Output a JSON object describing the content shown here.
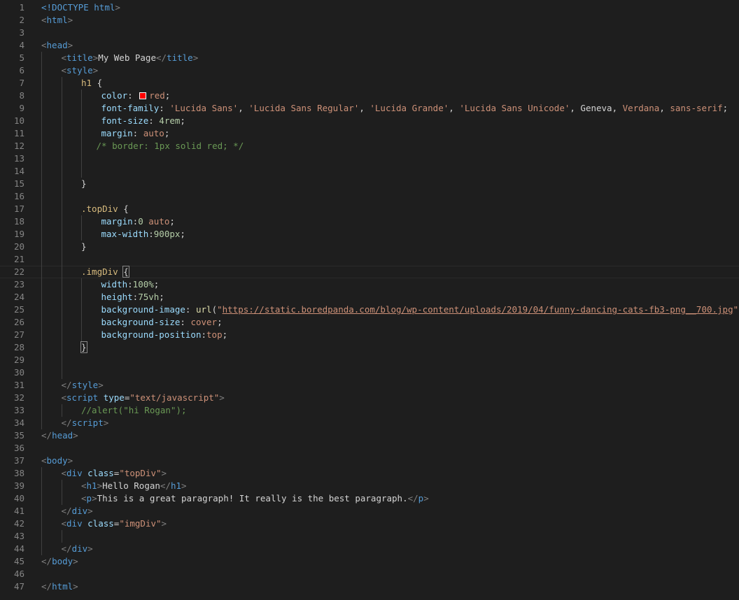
{
  "editor": {
    "lines": [
      {
        "n": "1",
        "indent": 0,
        "t": [
          [
            "doc",
            "<!DOCTYPE "
          ],
          [
            "tag",
            "html"
          ],
          [
            "punct",
            ">"
          ]
        ]
      },
      {
        "n": "2",
        "indent": 0,
        "t": [
          [
            "punct",
            "<"
          ],
          [
            "tag",
            "html"
          ],
          [
            "punct",
            ">"
          ]
        ]
      },
      {
        "n": "3",
        "indent": 0,
        "t": []
      },
      {
        "n": "4",
        "indent": 0,
        "t": [
          [
            "punct",
            "<"
          ],
          [
            "tag",
            "head"
          ],
          [
            "punct",
            ">"
          ]
        ]
      },
      {
        "n": "5",
        "indent": 1,
        "t": [
          [
            "punct",
            "<"
          ],
          [
            "tag",
            "title"
          ],
          [
            "punct",
            ">"
          ],
          [
            "txt",
            "My Web Page"
          ],
          [
            "punct",
            "</"
          ],
          [
            "tag",
            "title"
          ],
          [
            "punct",
            ">"
          ]
        ]
      },
      {
        "n": "6",
        "indent": 1,
        "t": [
          [
            "punct",
            "<"
          ],
          [
            "tag",
            "style"
          ],
          [
            "punct",
            ">"
          ]
        ]
      },
      {
        "n": "7",
        "indent": 2,
        "t": [
          [
            "sel",
            "h1"
          ],
          [
            "txt",
            " {"
          ]
        ]
      },
      {
        "n": "8",
        "indent": 3,
        "t": [
          [
            "prop",
            "color"
          ],
          [
            "txt",
            ": "
          ],
          [
            "swatch",
            ""
          ],
          [
            "val",
            "red"
          ],
          [
            "txt",
            ";"
          ]
        ]
      },
      {
        "n": "9",
        "indent": 3,
        "t": [
          [
            "prop",
            "font-family"
          ],
          [
            "txt",
            ": "
          ],
          [
            "val",
            "'Lucida Sans'"
          ],
          [
            "txt",
            ", "
          ],
          [
            "val",
            "'Lucida Sans Regular'"
          ],
          [
            "txt",
            ", "
          ],
          [
            "val",
            "'Lucida Grande'"
          ],
          [
            "txt",
            ", "
          ],
          [
            "val",
            "'Lucida Sans Unicode'"
          ],
          [
            "txt",
            ", Geneva, "
          ],
          [
            "val",
            "Verdana"
          ],
          [
            "txt",
            ", "
          ],
          [
            "val",
            "sans-serif"
          ],
          [
            "txt",
            ";"
          ]
        ]
      },
      {
        "n": "10",
        "indent": 3,
        "t": [
          [
            "prop",
            "font-size"
          ],
          [
            "txt",
            ": "
          ],
          [
            "num",
            "4rem"
          ],
          [
            "txt",
            ";"
          ]
        ]
      },
      {
        "n": "11",
        "indent": 3,
        "t": [
          [
            "prop",
            "margin"
          ],
          [
            "txt",
            ": "
          ],
          [
            "val",
            "auto"
          ],
          [
            "txt",
            ";"
          ]
        ]
      },
      {
        "n": "12",
        "indent": 3,
        "t": [
          [
            "cmt",
            "/* border: 1px solid red; */"
          ]
        ],
        "shift": -7
      },
      {
        "n": "13",
        "indent": 0,
        "t": []
      },
      {
        "n": "14",
        "indent": 0,
        "t": []
      },
      {
        "n": "15",
        "indent": 2,
        "t": [
          [
            "txt",
            "}"
          ]
        ]
      },
      {
        "n": "16",
        "indent": 0,
        "t": []
      },
      {
        "n": "17",
        "indent": 2,
        "t": [
          [
            "sel",
            ".topDiv"
          ],
          [
            "txt",
            " {"
          ]
        ]
      },
      {
        "n": "18",
        "indent": 3,
        "t": [
          [
            "prop",
            "margin"
          ],
          [
            "txt",
            ":"
          ],
          [
            "num",
            "0"
          ],
          [
            "txt",
            " "
          ],
          [
            "val",
            "auto"
          ],
          [
            "txt",
            ";"
          ]
        ]
      },
      {
        "n": "19",
        "indent": 3,
        "t": [
          [
            "prop",
            "max-width"
          ],
          [
            "txt",
            ":"
          ],
          [
            "num",
            "900px"
          ],
          [
            "txt",
            ";"
          ]
        ]
      },
      {
        "n": "20",
        "indent": 2,
        "t": [
          [
            "txt",
            "}"
          ]
        ]
      },
      {
        "n": "21",
        "indent": 0,
        "t": []
      },
      {
        "n": "22",
        "indent": 2,
        "t": [
          [
            "sel",
            ".imgDiv"
          ],
          [
            "txt",
            " "
          ],
          [
            "box",
            "{"
          ]
        ],
        "current": true
      },
      {
        "n": "23",
        "indent": 3,
        "t": [
          [
            "prop",
            "width"
          ],
          [
            "txt",
            ":"
          ],
          [
            "num",
            "100%"
          ],
          [
            "txt",
            ";"
          ]
        ]
      },
      {
        "n": "24",
        "indent": 3,
        "t": [
          [
            "prop",
            "height"
          ],
          [
            "txt",
            ":"
          ],
          [
            "num",
            "75vh"
          ],
          [
            "txt",
            ";"
          ]
        ]
      },
      {
        "n": "25",
        "indent": 3,
        "t": [
          [
            "prop",
            "background-image"
          ],
          [
            "txt",
            ": "
          ],
          [
            "fn",
            "url"
          ],
          [
            "txt",
            "("
          ],
          [
            "val",
            "\""
          ],
          [
            "url",
            "https://static.boredpanda.com/blog/wp-content/uploads/2019/04/funny-dancing-cats-fb3-png__700.jpg"
          ],
          [
            "val",
            "\""
          ],
          [
            "txt",
            ");"
          ]
        ]
      },
      {
        "n": "26",
        "indent": 3,
        "t": [
          [
            "prop",
            "background-size"
          ],
          [
            "txt",
            ": "
          ],
          [
            "val",
            "cover"
          ],
          [
            "txt",
            ";"
          ]
        ]
      },
      {
        "n": "27",
        "indent": 3,
        "t": [
          [
            "prop",
            "background-position"
          ],
          [
            "txt",
            ":"
          ],
          [
            "val",
            "top"
          ],
          [
            "txt",
            ";"
          ]
        ]
      },
      {
        "n": "28",
        "indent": 2,
        "t": [
          [
            "box",
            "}"
          ]
        ]
      },
      {
        "n": "29",
        "indent": 0,
        "t": []
      },
      {
        "n": "30",
        "indent": 0,
        "t": []
      },
      {
        "n": "31",
        "indent": 1,
        "t": [
          [
            "punct",
            "</"
          ],
          [
            "tag",
            "style"
          ],
          [
            "punct",
            ">"
          ]
        ]
      },
      {
        "n": "32",
        "indent": 1,
        "t": [
          [
            "punct",
            "<"
          ],
          [
            "tag",
            "script"
          ],
          [
            "txt",
            " "
          ],
          [
            "attr",
            "type"
          ],
          [
            "txt",
            "="
          ],
          [
            "str",
            "\"text/javascript\""
          ],
          [
            "punct",
            ">"
          ]
        ]
      },
      {
        "n": "33",
        "indent": 2,
        "t": [
          [
            "cmt",
            "//alert(\"hi Rogan\");"
          ]
        ]
      },
      {
        "n": "34",
        "indent": 1,
        "t": [
          [
            "punct",
            "</"
          ],
          [
            "tag",
            "script"
          ],
          [
            "punct",
            ">"
          ]
        ]
      },
      {
        "n": "35",
        "indent": 0,
        "t": [
          [
            "punct",
            "</"
          ],
          [
            "tag",
            "head"
          ],
          [
            "punct",
            ">"
          ]
        ]
      },
      {
        "n": "36",
        "indent": 0,
        "t": []
      },
      {
        "n": "37",
        "indent": 0,
        "t": [
          [
            "punct",
            "<"
          ],
          [
            "tag",
            "body"
          ],
          [
            "punct",
            ">"
          ]
        ]
      },
      {
        "n": "38",
        "indent": 1,
        "t": [
          [
            "punct",
            "<"
          ],
          [
            "tag",
            "div"
          ],
          [
            "txt",
            " "
          ],
          [
            "attr",
            "class"
          ],
          [
            "txt",
            "="
          ],
          [
            "str",
            "\"topDiv\""
          ],
          [
            "punct",
            ">"
          ]
        ]
      },
      {
        "n": "39",
        "indent": 2,
        "t": [
          [
            "punct",
            "<"
          ],
          [
            "tag",
            "h1"
          ],
          [
            "punct",
            ">"
          ],
          [
            "txt",
            "Hello Rogan"
          ],
          [
            "punct",
            "</"
          ],
          [
            "tag",
            "h1"
          ],
          [
            "punct",
            ">"
          ]
        ]
      },
      {
        "n": "40",
        "indent": 2,
        "t": [
          [
            "punct",
            "<"
          ],
          [
            "tag",
            "p"
          ],
          [
            "punct",
            ">"
          ],
          [
            "txt",
            "This is a great paragraph! It really is the best paragraph."
          ],
          [
            "punct",
            "</"
          ],
          [
            "tag",
            "p"
          ],
          [
            "punct",
            ">"
          ]
        ]
      },
      {
        "n": "41",
        "indent": 1,
        "t": [
          [
            "punct",
            "</"
          ],
          [
            "tag",
            "div"
          ],
          [
            "punct",
            ">"
          ]
        ]
      },
      {
        "n": "42",
        "indent": 1,
        "t": [
          [
            "punct",
            "<"
          ],
          [
            "tag",
            "div"
          ],
          [
            "txt",
            " "
          ],
          [
            "attr",
            "class"
          ],
          [
            "txt",
            "="
          ],
          [
            "str",
            "\"imgDiv\""
          ],
          [
            "punct",
            ">"
          ]
        ]
      },
      {
        "n": "43",
        "indent": 0,
        "t": []
      },
      {
        "n": "44",
        "indent": 1,
        "t": [
          [
            "punct",
            "</"
          ],
          [
            "tag",
            "div"
          ],
          [
            "punct",
            ">"
          ]
        ]
      },
      {
        "n": "45",
        "indent": 0,
        "t": [
          [
            "punct",
            "</"
          ],
          [
            "tag",
            "body"
          ],
          [
            "punct",
            ">"
          ]
        ]
      },
      {
        "n": "46",
        "indent": 0,
        "t": []
      },
      {
        "n": "47",
        "indent": 0,
        "t": [
          [
            "punct",
            "</"
          ],
          [
            "tag",
            "html"
          ],
          [
            "punct",
            ">"
          ]
        ]
      }
    ]
  },
  "colors": {
    "background": "#1e1e1e",
    "line_number": "#858585",
    "tag": "#569cd6",
    "string": "#ce9178",
    "attribute": "#9cdcfe",
    "selector": "#d7ba7d",
    "number": "#b5cea8",
    "comment": "#6a9955"
  }
}
